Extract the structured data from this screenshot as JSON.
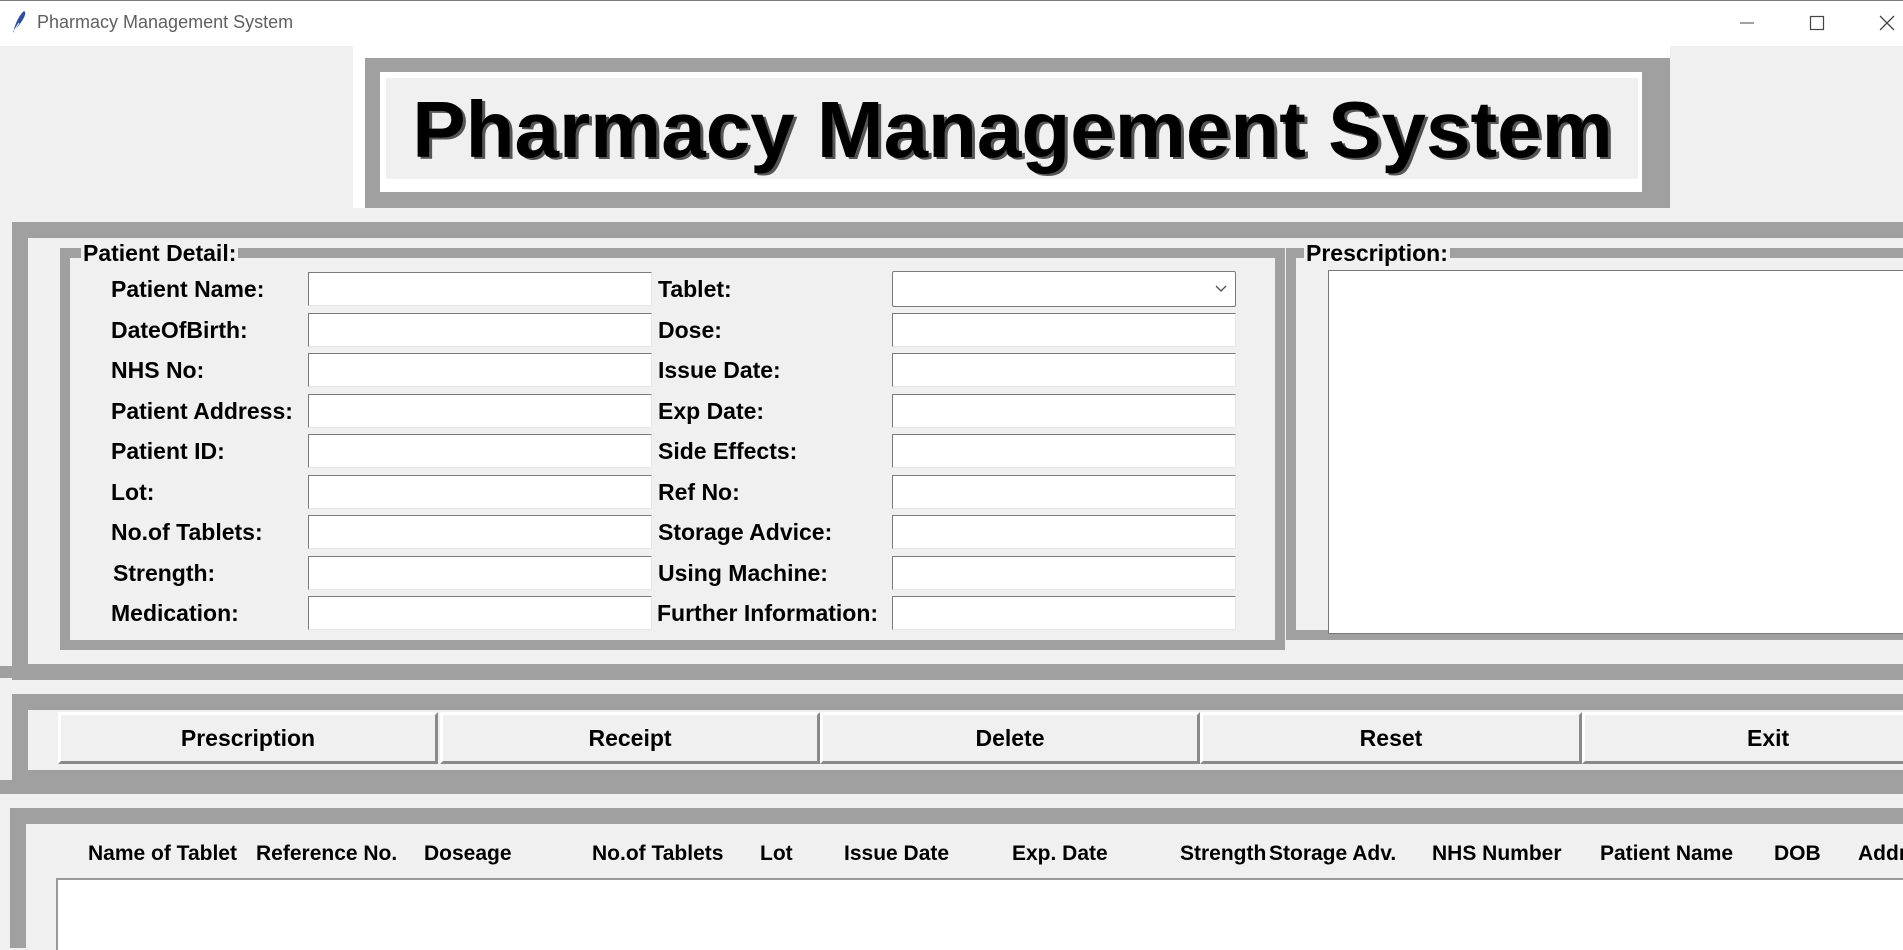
{
  "window": {
    "title": "Pharmacy Management System"
  },
  "header": {
    "title": "Pharmacy Management System"
  },
  "patient_detail": {
    "group_label": "Patient Detail:",
    "left_fields": [
      {
        "label": "Patient Name:",
        "value": ""
      },
      {
        "label": "DateOfBirth:",
        "value": ""
      },
      {
        "label": "NHS No:",
        "value": ""
      },
      {
        "label": "Patient Address:",
        "value": ""
      },
      {
        "label": "Patient ID:",
        "value": ""
      },
      {
        "label": "Lot:",
        "value": ""
      },
      {
        "label": "No.of Tablets:",
        "value": ""
      },
      {
        "label": "Strength:",
        "value": ""
      },
      {
        "label": "Medication:",
        "value": ""
      }
    ],
    "right_fields": [
      {
        "label": "Tablet:",
        "value": ""
      },
      {
        "label": "Dose:",
        "value": ""
      },
      {
        "label": "Issue Date:",
        "value": ""
      },
      {
        "label": "Exp Date:",
        "value": ""
      },
      {
        "label": "Side Effects:",
        "value": ""
      },
      {
        "label": "Ref No:",
        "value": ""
      },
      {
        "label": "Storage Advice:",
        "value": ""
      },
      {
        "label": "Using Machine:",
        "value": ""
      },
      {
        "label": "Further Information:",
        "value": ""
      }
    ]
  },
  "prescription": {
    "group_label": "Prescription:",
    "text": ""
  },
  "buttons": {
    "prescription": "Prescription",
    "receipt": "Receipt",
    "delete": "Delete",
    "reset": "Reset",
    "exit": "Exit"
  },
  "table": {
    "columns": [
      "Name of Tablet",
      "Reference No.",
      "Doseage",
      "No.of Tablets",
      "Lot",
      "Issue Date",
      "Exp. Date",
      "Strength",
      "Storage Adv.",
      "NHS Number",
      "Patient Name",
      "DOB",
      "Addr"
    ]
  },
  "colors": {
    "background": "#f0f0f0",
    "ridge": "#a0a0a0",
    "field": "#ffffff"
  }
}
